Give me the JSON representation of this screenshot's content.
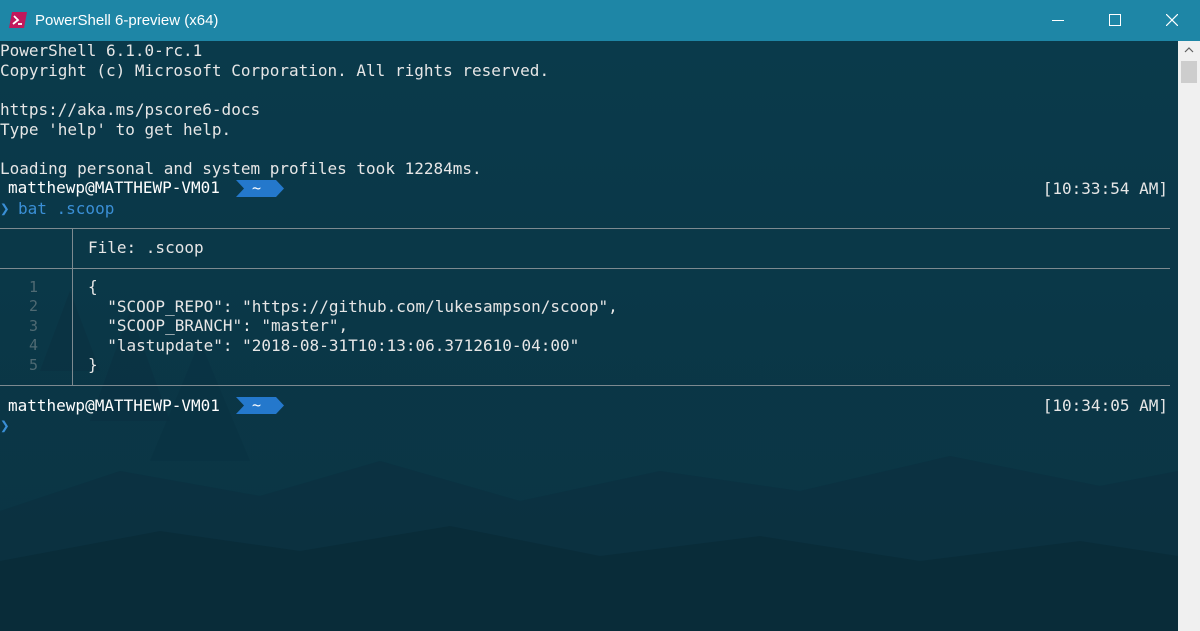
{
  "window": {
    "title": "PowerShell 6-preview (x64)",
    "icons": {
      "app": "powershell-icon",
      "minimize": "minimize-icon",
      "maximize": "maximize-icon",
      "close": "close-icon"
    }
  },
  "colors": {
    "titlebar": "#1e86a6",
    "console_bg": "#0a3646",
    "text": "#e6e6e6",
    "accent_blue": "#3a8fd6",
    "segment_blue": "#2478cc",
    "line_number": "#4f6a73"
  },
  "console": {
    "banner": {
      "version": "PowerShell 6.1.0-rc.1",
      "copyright": "Copyright (c) Microsoft Corporation. All rights reserved.",
      "docs": "https://aka.ms/pscore6-docs",
      "help": "Type 'help' to get help.",
      "profile": "Loading personal and system profiles took 12284ms."
    },
    "prompts": [
      {
        "user": "matthewp@MATTHEWP-VM01",
        "dir": "~",
        "time": "[10:33:54 AM]",
        "chevron": "❯",
        "command": "bat .scoop"
      },
      {
        "user": "matthewp@MATTHEWP-VM01",
        "dir": "~",
        "time": "[10:34:05 AM]",
        "chevron": "❯",
        "command": ""
      }
    ],
    "bat": {
      "header": "File: .scoop",
      "line_numbers": [
        "1",
        "2",
        "3",
        "4",
        "5"
      ],
      "lines": [
        "{",
        "  \"SCOOP_REPO\": \"https://github.com/lukesampson/scoop\",",
        "  \"SCOOP_BRANCH\": \"master\",",
        "  \"lastupdate\": \"2018-08-31T10:13:06.3712610-04:00\"",
        "}"
      ]
    }
  }
}
